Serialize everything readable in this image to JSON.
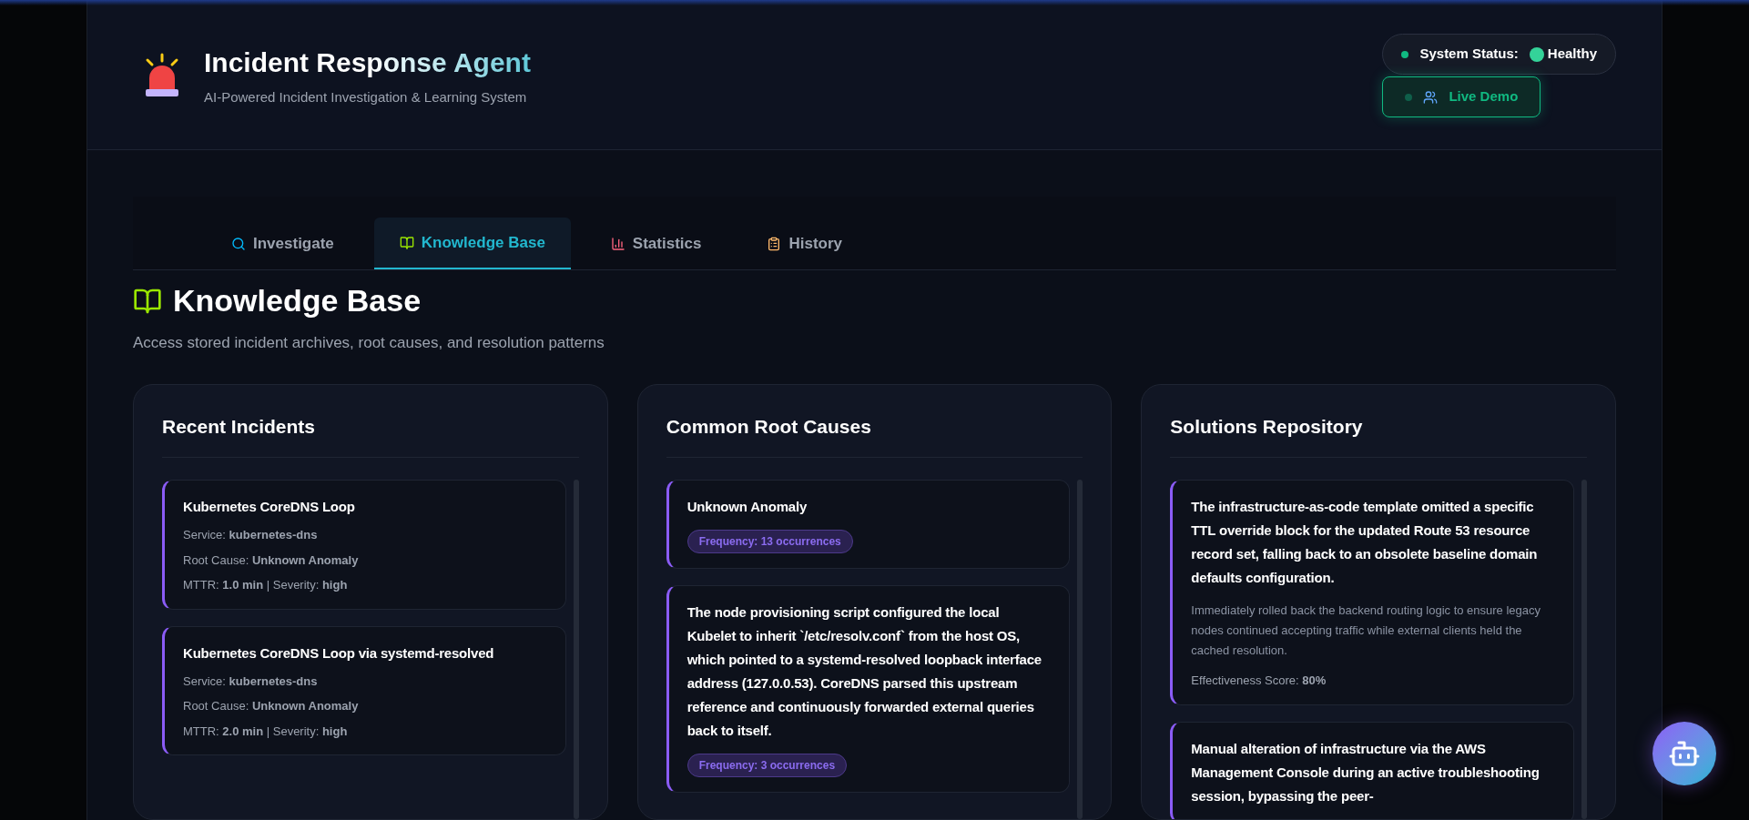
{
  "header": {
    "title": "Incident Response Agent",
    "subtitle": "AI-Powered Incident Investigation & Learning System",
    "status": {
      "label": "System Status:",
      "value": "Healthy",
      "healthy": true
    },
    "live_demo": {
      "label": "Live Demo",
      "active": true
    }
  },
  "tabs": [
    {
      "label": "Investigate",
      "selected": false
    },
    {
      "label": "Knowledge Base",
      "selected": true
    },
    {
      "label": "Statistics",
      "selected": false
    },
    {
      "label": "History",
      "selected": false
    }
  ],
  "page": {
    "title": "Knowledge Base",
    "subtitle": "Access stored incident archives, root causes, and resolution patterns"
  },
  "panels": [
    {
      "title": "Recent Incidents",
      "kind": "incidents",
      "items": [
        {
          "title": "Kubernetes CoreDNS Loop",
          "lines": [
            "Service: **kubernetes-dns**",
            "Root Cause: **Unknown Anomaly**",
            "MTTR: **1.0 min** | Severity: **high**"
          ]
        },
        {
          "title": "Kubernetes CoreDNS Loop via systemd-resolved",
          "lines": [
            "Service: **kubernetes-dns**",
            "Root Cause: **Unknown Anomaly**",
            "MTTR: **2.0 min** | Severity: **high**"
          ]
        }
      ]
    },
    {
      "title": "Common Root Causes",
      "kind": "causes",
      "items": [
        {
          "title": "Unknown Anomaly",
          "badge": "Frequency: 13 occurrences"
        },
        {
          "title": "The node provisioning script configured the local Kubelet to inherit `/etc/resolv.conf` from the host OS, which pointed to a systemd-resolved loopback interface address (127.0.0.53). CoreDNS parsed this upstream reference and continuously forwarded external queries back to itself.",
          "badge": "Frequency: 3 occurrences"
        }
      ]
    },
    {
      "title": "Solutions Repository",
      "kind": "solutions",
      "items": [
        {
          "title": "The infrastructure-as-code template omitted a specific TTL override block for the updated Route 53 resource record set, falling back to an obsolete baseline domain defaults configuration.",
          "description": "Immediately rolled back the backend routing logic to ensure legacy nodes continued accepting traffic while external clients held the cached resolution.",
          "score": "Effectiveness Score: **80%**"
        },
        {
          "title": "Manual alteration of infrastructure via the AWS Management Console during an active troubleshooting session, bypassing the peer-"
        }
      ]
    }
  ]
}
